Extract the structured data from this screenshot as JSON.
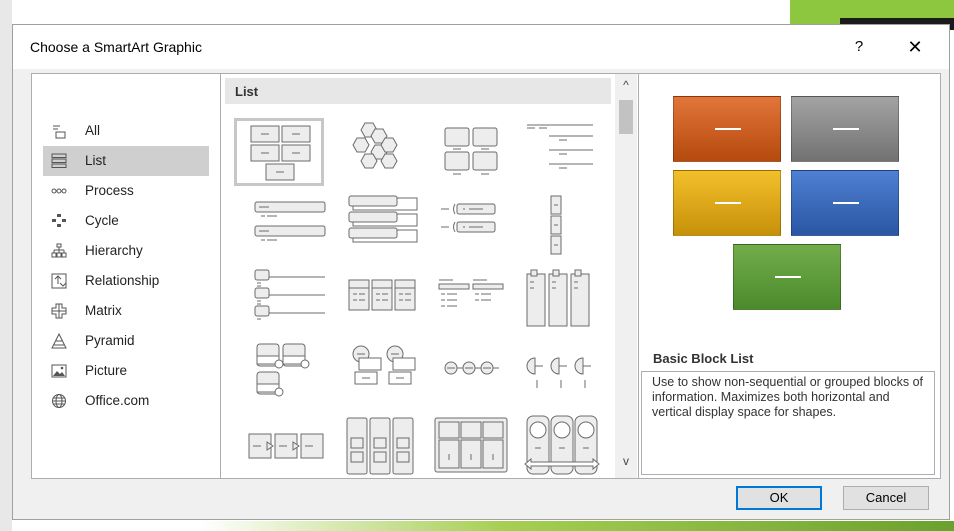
{
  "dialog": {
    "title": "Choose a SmartArt Graphic",
    "help_label": "?",
    "close_label": "✕"
  },
  "categories": [
    {
      "label": "All",
      "icon": "all-icon",
      "selected": false
    },
    {
      "label": "List",
      "icon": "list-icon",
      "selected": true
    },
    {
      "label": "Process",
      "icon": "process-icon",
      "selected": false
    },
    {
      "label": "Cycle",
      "icon": "cycle-icon",
      "selected": false
    },
    {
      "label": "Hierarchy",
      "icon": "hierarchy-icon",
      "selected": false
    },
    {
      "label": "Relationship",
      "icon": "relationship-icon",
      "selected": false
    },
    {
      "label": "Matrix",
      "icon": "matrix-icon",
      "selected": false
    },
    {
      "label": "Pyramid",
      "icon": "pyramid-icon",
      "selected": false
    },
    {
      "label": "Picture",
      "icon": "picture-icon",
      "selected": false
    },
    {
      "label": "Office.com",
      "icon": "globe-icon",
      "selected": false
    }
  ],
  "gallery": {
    "header": "List",
    "scroll_up": "^",
    "scroll_down": "v"
  },
  "preview": {
    "title": "Basic Block List",
    "description": "Use to show non-sequential or grouped blocks of information. Maximizes both horizontal and vertical display space for shapes.",
    "colors": [
      "#d35f1f",
      "#8c8c8c",
      "#e0aa10",
      "#3a6bbf",
      "#5d9c3a"
    ]
  },
  "buttons": {
    "ok": "OK",
    "cancel": "Cancel"
  }
}
